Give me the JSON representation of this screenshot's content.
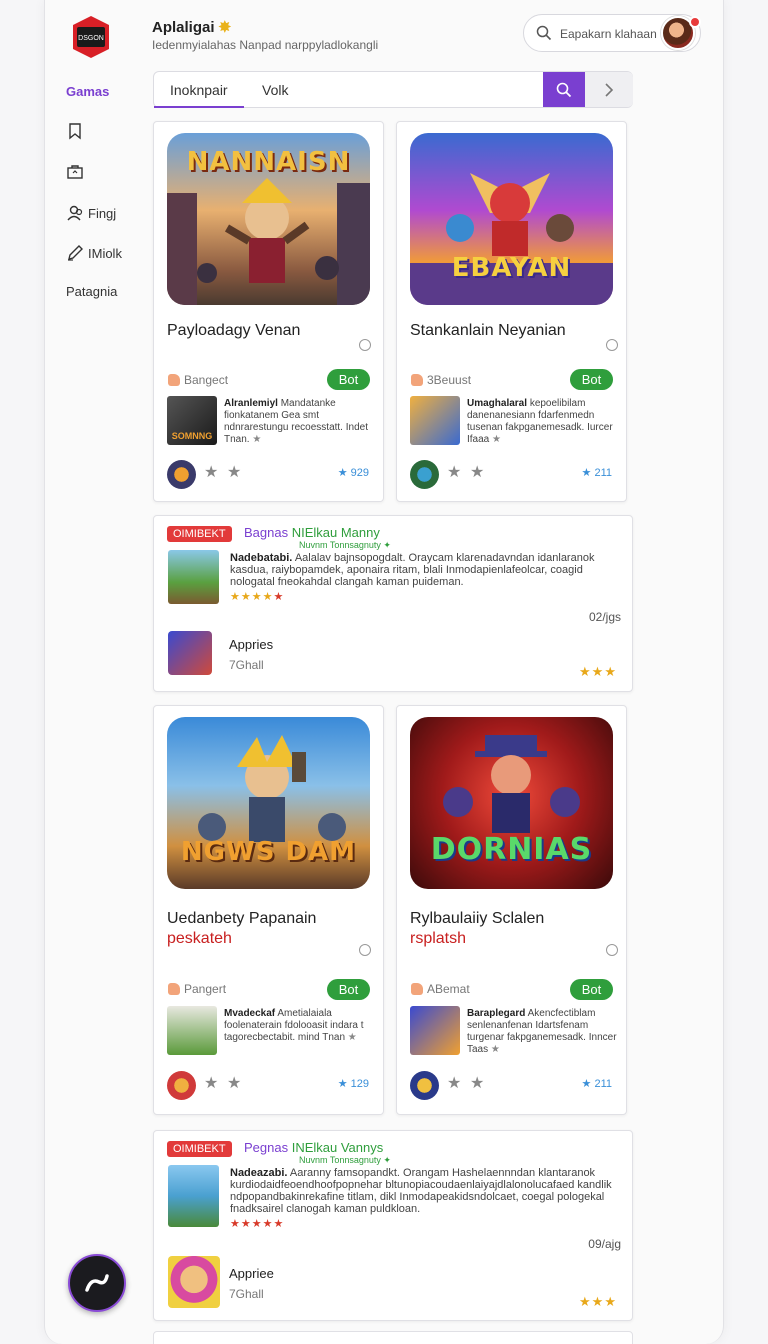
{
  "header": {
    "logo_text": "DSGON",
    "app_title": "Aplaligai",
    "app_subtitle": "Iedenmyialahas Nanpad narppyladlokangli",
    "search_placeholder": "Eapakarn klahaan",
    "avatar_icon": "user-avatar"
  },
  "sidebar": {
    "games_label": "Gamas",
    "items": [
      {
        "icon": "bookmark-icon",
        "label": ""
      },
      {
        "icon": "briefcase-icon",
        "label": ""
      },
      {
        "icon": "users-icon",
        "label": "Fingj"
      },
      {
        "icon": "pen-icon",
        "label": "IMiolk"
      },
      {
        "icon": "",
        "label": "Patagnia"
      }
    ]
  },
  "tabs": {
    "items": [
      "Inoknpair",
      "Volk"
    ],
    "active": 0
  },
  "cards_row1": [
    {
      "art_text": "NANNAISN",
      "title": "Payloadagy Venan",
      "title_line2": "",
      "tag": "Bangect",
      "button": "Bot",
      "thumb_text": "SOMNNG",
      "desc_bold": "Alranlemiyl",
      "desc": "Mandatanke fionkatanem Gea smt ndnrarestungu recoesstatt. Indet Tnan.",
      "rating": "929"
    },
    {
      "art_text": "EBAYAN",
      "title": "Stankanlain Neyanian",
      "title_line2": "",
      "tag": "3Beuust",
      "button": "Bot",
      "thumb_text": "",
      "desc_bold": "Umaghalaral",
      "desc": "kepoelibilam danenanesiann fdarfenmedn tusenan fakpganemesadk. Iurcer Ifaaa",
      "rating": "211"
    }
  ],
  "wide1": {
    "badge": "OIMIBEKT",
    "title_purple": "Bagnas",
    "title_green": "NIElkau Manny",
    "subtitle": "Nuvnm Tonnsagnuty",
    "desc_bold": "Nadebatabi.",
    "desc": "Aalalav bajnsopogdalt.  Oraycam klarenadavndan idanlaranok kasdua, raiybopamdek, aponaira ritam, blali Inmodapienlafeolcar, coagid nologatal fneokahdal clangah kaman puideman.",
    "count": "02/jgs",
    "app_name": "Appries",
    "app_size": "7Ghall"
  },
  "cards_row2": [
    {
      "art_text": "NGWS DAM",
      "title": "Uedanbety Papanain",
      "title_line2": "peskateh",
      "tag": "Pangert",
      "button": "Bot",
      "desc_bold": "Mvadeckaf",
      "desc": "Ametialaiala foolenaterain fdolooasit indara t tagorecbectabit. mind Tnan",
      "rating": "129"
    },
    {
      "art_text": "DORNIAS",
      "title": "Rylbaulaiiy Sclalen",
      "title_line2": "rsplatsh",
      "tag": "ABemat",
      "button": "Bot",
      "desc_bold": "Baraplegard",
      "desc": "Akencfectiblam senlenanfenan Idartsfenam turgenar fakpganemesadk. Inncer Taas",
      "rating": "211"
    }
  ],
  "wide2": {
    "badge": "OIMIBEKT",
    "title_purple": "Pegnas",
    "title_green": "INElkau Vannys",
    "subtitle": "Nuvnm Tonnsagnuty",
    "desc_bold": "Nadeazabi.",
    "desc": "Aaranny famsopandkt.  Orangam Hashelaennndan klantaranok kurdiodaidfeoendhoofpopnehar bltunopiacoudaenlaiyajdlalonolucafaed kandlik ndpopandbakinrekafine titlam, dikl Inmodapeakidsndolcaet, coegal pologekal fnadksairel clanogah kaman puldkloan.",
    "count": "09/ajg",
    "app_name": "Appriee",
    "app_size": "7Ghall"
  },
  "colors": {
    "accent": "#7a3fd0",
    "get_button": "#2f9e3c",
    "badge": "#e23a3a",
    "star_gold": "#e8a81a",
    "rating_blue": "#3a8fd8"
  },
  "fab_icon": "swoosh-icon"
}
